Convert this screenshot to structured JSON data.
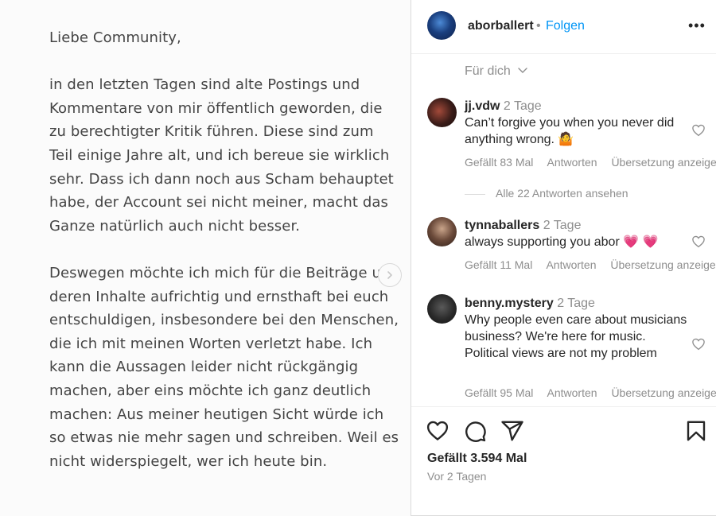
{
  "post_text": {
    "paragraphs": [
      "Liebe Community,",
      "in den letzten Tagen sind alte Postings und Kommentare von mir öffentlich geworden, die zu berechtigter Kritik führen. Diese sind zum Teil einige Jahre alt, und ich bereue sie wirklich sehr. Dass ich dann noch aus Scham behauptet habe, der Account sei nicht meiner, macht das Ganze natürlich auch nicht besser.",
      "Deswegen möchte ich mich für die Beiträge und deren Inhalte aufrichtig und ernsthaft bei euch entschuldigen, insbesondere bei den Menschen, die ich mit meinen Worten verletzt habe. Ich kann die Aussagen leider nicht rückgängig machen, aber eins möchte ich ganz deutlich machen: Aus meiner heutigen Sicht würde ich so etwas nie mehr sagen und schreiben. Weil es nicht widerspiegelt, wer ich heute bin."
    ]
  },
  "header": {
    "username": "aborballert",
    "separator": "•",
    "follow_label": "Folgen",
    "more_label": "•••"
  },
  "sort": {
    "label": "Für dich"
  },
  "comments": [
    {
      "username": "jj.vdw",
      "time": "2 Tage",
      "text": "Can’t forgive you when you never did anything wrong. 🤷",
      "likes": "Gefällt 83 Mal",
      "reply": "Antworten",
      "translate": "Übersetzung anzeigen"
    },
    {
      "username": "tynnaballers",
      "time": "2 Tage",
      "text": "always supporting you abor 💗 💗",
      "likes": "Gefällt 11 Mal",
      "reply": "Antworten",
      "translate": "Übersetzung anzeigen"
    },
    {
      "username": "benny.mystery",
      "time": "2 Tage",
      "text": "Why people even care about musicians business? We're here for music. Political views are not my problem",
      "likes": "Gefällt 95 Mal",
      "reply": "Antworten",
      "translate": "Übersetzung anzeigen"
    }
  ],
  "view_replies": "Alle 22 Antworten ansehen",
  "footer": {
    "likes": "Gefällt 3.594 Mal",
    "time": "Vor 2 Tagen"
  },
  "icons": {
    "like": "heart-icon",
    "comment": "comment-icon",
    "share": "share-icon",
    "save": "bookmark-icon",
    "next": "chevron-right-icon"
  },
  "colors": {
    "follow": "#0095f6",
    "text": "#262626",
    "muted": "#8e8e8e"
  }
}
